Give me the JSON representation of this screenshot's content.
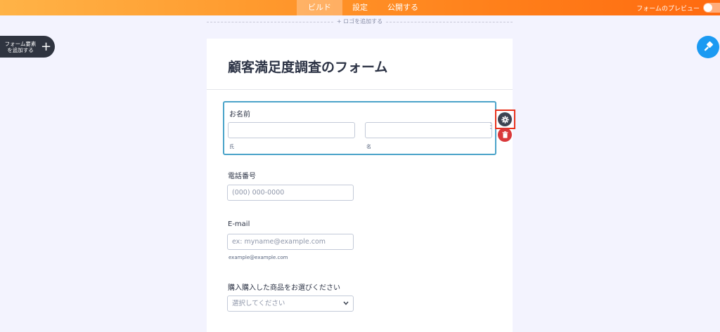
{
  "topbar": {
    "tabs": [
      {
        "label": "ビルド",
        "active": true
      },
      {
        "label": "設定",
        "active": false
      },
      {
        "label": "公開する",
        "active": false
      }
    ],
    "preview_label": "フォームのプレビュー"
  },
  "logo": {
    "add_label": "+ ロゴを追加する"
  },
  "add_elements": {
    "label": "フォーム要素を追加する"
  },
  "form": {
    "title": "顧客満足度調査のフォーム",
    "name_field": {
      "label": "お名前",
      "first_sublabel": "氏",
      "last_sublabel": "名"
    },
    "phone_field": {
      "label": "電話番号",
      "placeholder": "(000) 000-0000"
    },
    "email_field": {
      "label": "E-mail",
      "placeholder": "ex: myname@example.com",
      "sublabel": "example@example.com"
    },
    "product_field": {
      "label": "購入購入した商品をお選びください",
      "selected": "選択してください"
    }
  },
  "icons": {
    "paint": "paint-roller-icon",
    "gear": "gear-icon",
    "trash": "trash-icon"
  },
  "colors": {
    "accent_selection": "#4aa3c9",
    "highlight": "#e8321c",
    "paint_button": "#1b9af2",
    "delete_button": "#d9383a"
  }
}
